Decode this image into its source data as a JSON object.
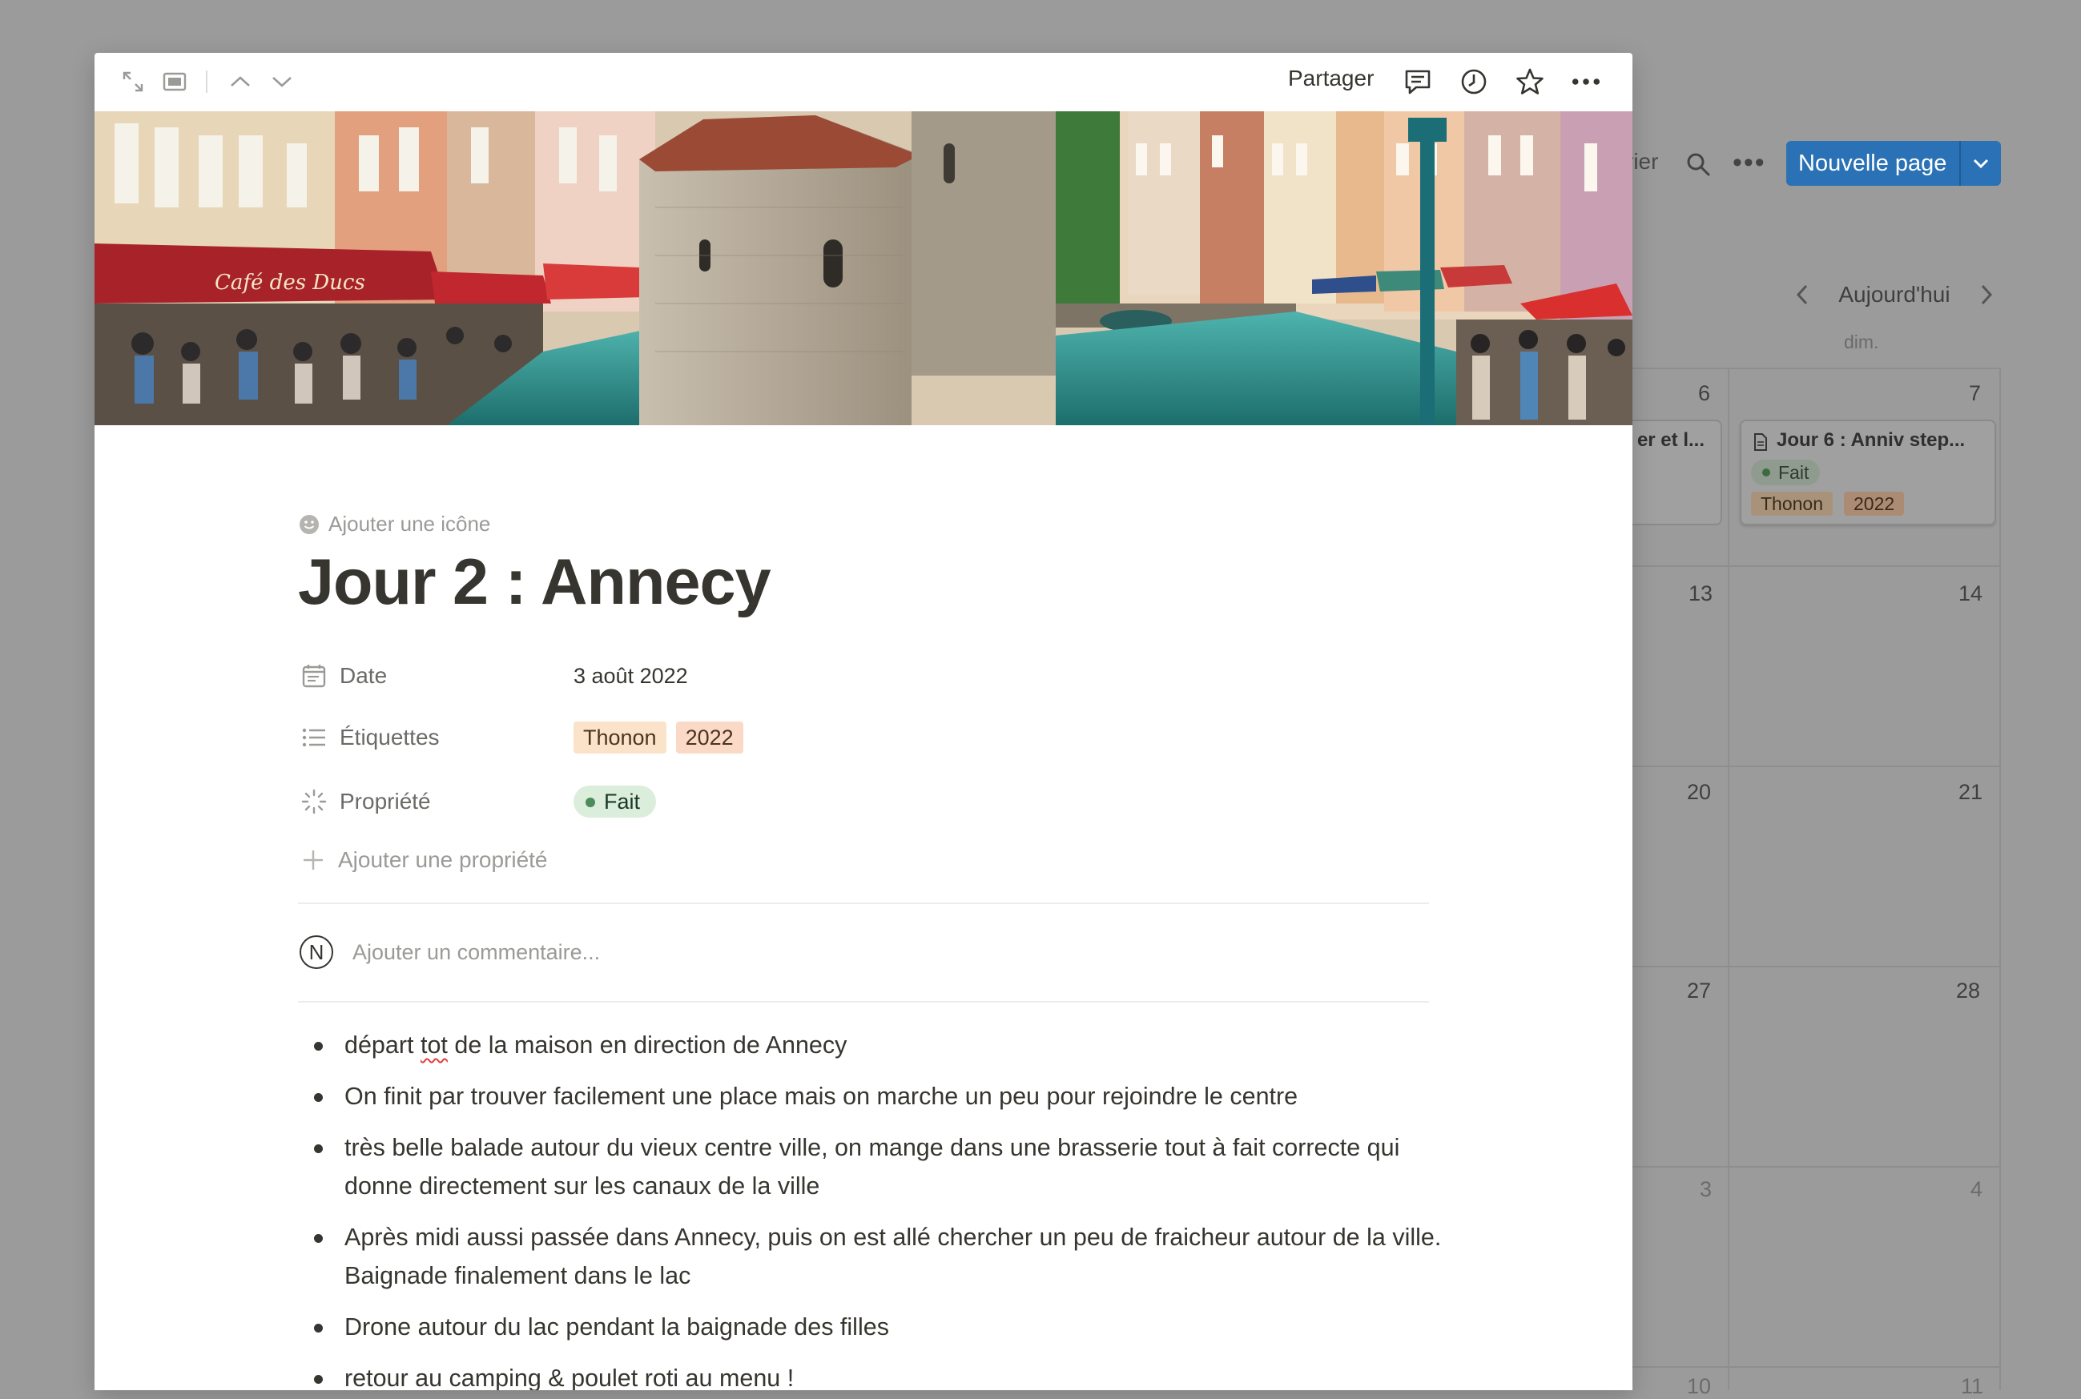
{
  "background_calendar": {
    "toolbar_partial_text": "rier",
    "search_icon": "search-icon",
    "more_icon": "more-horizontal-icon",
    "new_page_button": "Nouvelle page",
    "today_button": "Aujourd'hui",
    "day_header": "dim.",
    "dates": [
      "6",
      "7",
      "13",
      "14",
      "20",
      "21",
      "27",
      "28",
      "3",
      "4",
      "10",
      "11"
    ],
    "left_card_title": "er et l...",
    "card": {
      "title": "Jour 6 : Anniv step...",
      "status": "Fait",
      "tags": [
        "Thonon",
        "2022"
      ]
    }
  },
  "modal": {
    "topbar": {
      "icons_left": [
        "expand-icon",
        "side-peek-icon",
        "chevron-up-icon",
        "chevron-down-icon"
      ],
      "share_label": "Partager",
      "icons_right": [
        "comment-icon",
        "history-clock-icon",
        "star-icon",
        "more-horizontal-icon"
      ]
    },
    "cover": {
      "description_icon": "cover-image"
    },
    "add_icon_label": "Ajouter une icône",
    "title": "Jour 2 : Annecy",
    "properties": [
      {
        "icon": "calendar-icon",
        "name": "Date",
        "value": "3 août 2022"
      },
      {
        "icon": "list-icon",
        "name": "Étiquettes",
        "tags": [
          "Thonon",
          "2022"
        ]
      },
      {
        "icon": "status-icon",
        "name": "Propriété",
        "status": "Fait"
      }
    ],
    "add_property_label": "Ajouter une propriété",
    "comment": {
      "avatar_letter": "N",
      "placeholder": "Ajouter un commentaire..."
    },
    "bullets": {
      "b1_a": "départ ",
      "b1_sq": "tot",
      "b1_b": " de la maison en direction de Annecy",
      "b2": "On finit par trouver facilement une place mais on marche un peu pour rejoindre le centre",
      "b3": "très belle balade autour du vieux centre ville, on mange dans une brasserie tout à fait correcte qui donne directement sur les canaux de la ville",
      "b4": "Après midi aussi passée dans Annecy, puis on est allé chercher un peu de fraicheur autour de la ville. Baignade finalement dans le lac",
      "b5": "Drone autour du lac pendant la baignade des filles",
      "b6_a": "retour au camping & poulet ",
      "b6_sq": "roti",
      "b6_b": " au menu !"
    }
  },
  "colors": {
    "accent_blue": "#2a72b5",
    "tag_thonon": "#fae3c8",
    "tag_2022": "#fbd9c7",
    "status_green": "#dbeddb"
  }
}
